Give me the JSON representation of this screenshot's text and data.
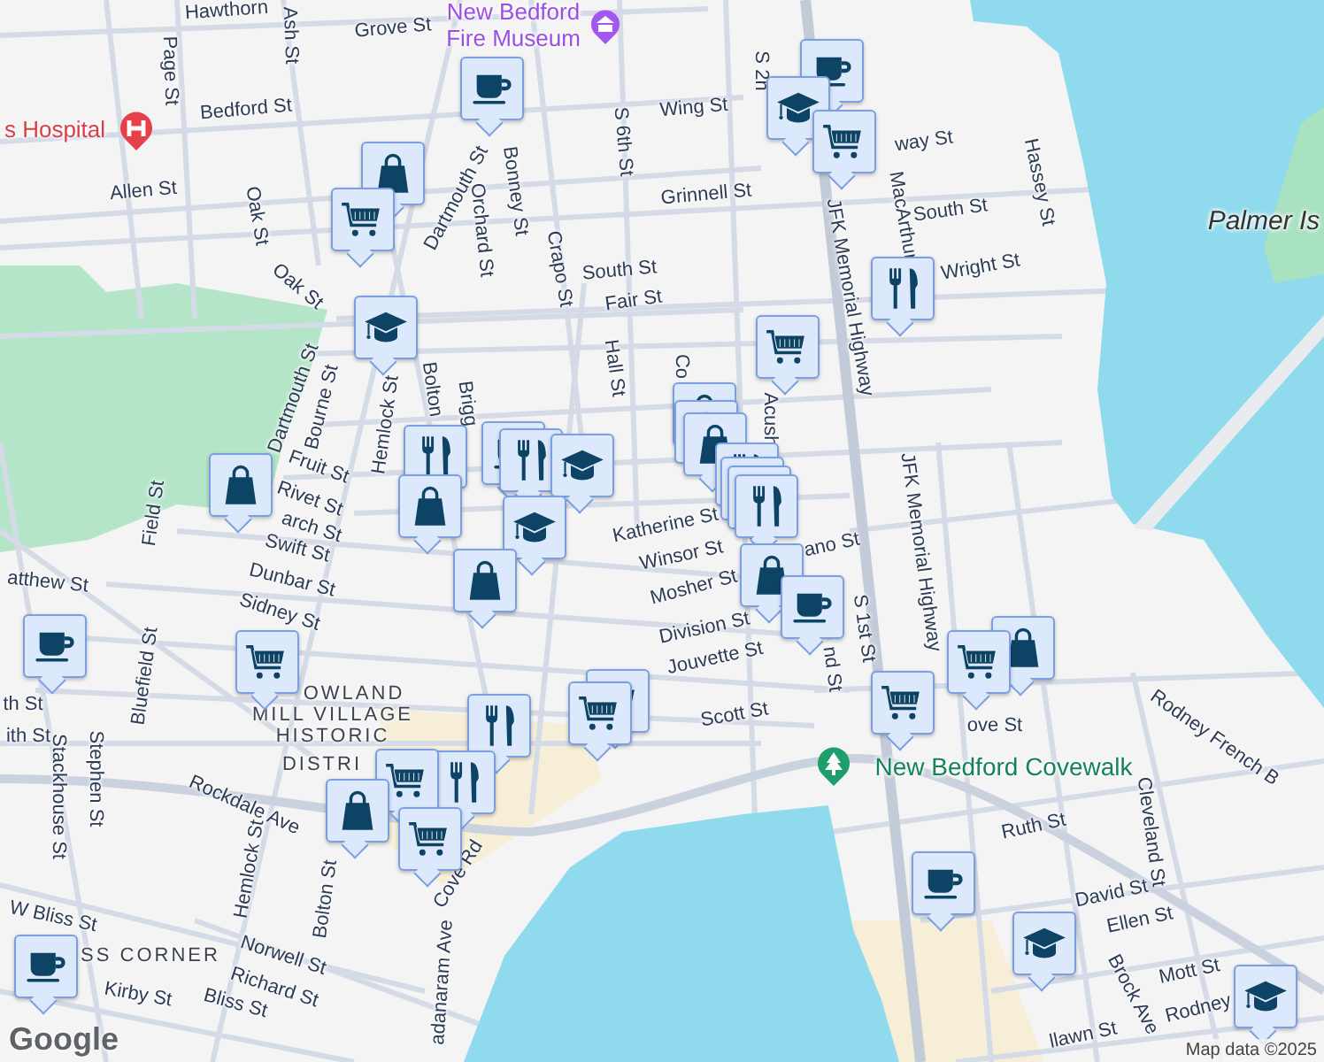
{
  "map": {
    "labels": [
      {
        "text": "Hawthorn",
        "kind": "street"
      },
      {
        "text": "Page St",
        "kind": "street"
      },
      {
        "text": "Ash St",
        "kind": "street"
      },
      {
        "text": "Grove St",
        "kind": "street"
      },
      {
        "text": "New Bedford Fire Museum",
        "kind": "museum"
      },
      {
        "text": "s Hospital",
        "kind": "hospital"
      },
      {
        "text": "Bedford St",
        "kind": "street"
      },
      {
        "text": "S 6th St",
        "kind": "street"
      },
      {
        "text": "Wing St",
        "kind": "street"
      },
      {
        "text": "S 2n",
        "kind": "street"
      },
      {
        "text": "way St",
        "kind": "street"
      },
      {
        "text": "Allen St",
        "kind": "street"
      },
      {
        "text": "Oak St",
        "kind": "street"
      },
      {
        "text": "Dartmouth St",
        "kind": "street"
      },
      {
        "text": "Bonney St",
        "kind": "street"
      },
      {
        "text": "Orchard St",
        "kind": "street"
      },
      {
        "text": "Grinnell St",
        "kind": "street"
      },
      {
        "text": "JFK Memorial Highway",
        "kind": "street"
      },
      {
        "text": "MacArthur",
        "kind": "street"
      },
      {
        "text": "South St",
        "kind": "street"
      },
      {
        "text": "Hassey St",
        "kind": "street"
      },
      {
        "text": "Palmer Is",
        "kind": "island"
      },
      {
        "text": "Oak St",
        "kind": "street"
      },
      {
        "text": "Crapo St",
        "kind": "street"
      },
      {
        "text": "South St",
        "kind": "street"
      },
      {
        "text": "Fair St",
        "kind": "street"
      },
      {
        "text": "Wright St",
        "kind": "street"
      },
      {
        "text": "Hall St",
        "kind": "street"
      },
      {
        "text": "Co",
        "kind": "street"
      },
      {
        "text": "Acush",
        "kind": "street"
      },
      {
        "text": "Dartmouth St",
        "kind": "street"
      },
      {
        "text": "Bourne St",
        "kind": "street"
      },
      {
        "text": "Hemlock St",
        "kind": "street"
      },
      {
        "text": "Bolton",
        "kind": "street"
      },
      {
        "text": "Brigg",
        "kind": "street"
      },
      {
        "text": "Fruit St",
        "kind": "street"
      },
      {
        "text": "Rivet St",
        "kind": "street"
      },
      {
        "text": "Field St",
        "kind": "street"
      },
      {
        "text": "arch St",
        "kind": "street"
      },
      {
        "text": "Katherine St",
        "kind": "street"
      },
      {
        "text": "Winsor St",
        "kind": "street"
      },
      {
        "text": "ano St",
        "kind": "street"
      },
      {
        "text": "Swift St",
        "kind": "street"
      },
      {
        "text": "Dunbar St",
        "kind": "street"
      },
      {
        "text": "atthew St",
        "kind": "street"
      },
      {
        "text": "Mosher St",
        "kind": "street"
      },
      {
        "text": "Sidney St",
        "kind": "street"
      },
      {
        "text": "Division St",
        "kind": "street"
      },
      {
        "text": "S 1st St",
        "kind": "street"
      },
      {
        "text": "JFK Memorial Highway",
        "kind": "street"
      },
      {
        "text": "Jouvette St",
        "kind": "street"
      },
      {
        "text": "nd St",
        "kind": "street"
      },
      {
        "text": "Bluefield St",
        "kind": "street"
      },
      {
        "text": "OWLAND",
        "kind": "district"
      },
      {
        "text": "MILL VILLAGE",
        "kind": "district"
      },
      {
        "text": "HISTORIC",
        "kind": "district"
      },
      {
        "text": "DISTRI",
        "kind": "district"
      },
      {
        "text": "th St",
        "kind": "street"
      },
      {
        "text": "ith St",
        "kind": "street"
      },
      {
        "text": "Scott St",
        "kind": "street"
      },
      {
        "text": "ove St",
        "kind": "street"
      },
      {
        "text": "Rodney French B",
        "kind": "street"
      },
      {
        "text": "New Bedford Covewalk",
        "kind": "park"
      },
      {
        "text": "Stackhouse St",
        "kind": "street"
      },
      {
        "text": "Stephen St",
        "kind": "street"
      },
      {
        "text": "Rockdale Ave",
        "kind": "street"
      },
      {
        "text": "Ruth St",
        "kind": "street"
      },
      {
        "text": "Cleveland St",
        "kind": "street"
      },
      {
        "text": "Cove Rd",
        "kind": "street"
      },
      {
        "text": "Hemlock St",
        "kind": "street"
      },
      {
        "text": "Bolton St",
        "kind": "street"
      },
      {
        "text": "David St",
        "kind": "street"
      },
      {
        "text": "Ellen St",
        "kind": "street"
      },
      {
        "text": "W Bliss St",
        "kind": "street"
      },
      {
        "text": "SS CORNER",
        "kind": "district"
      },
      {
        "text": "Norwell St",
        "kind": "street"
      },
      {
        "text": "Richard St",
        "kind": "street"
      },
      {
        "text": "Kirby St",
        "kind": "street"
      },
      {
        "text": "Bliss St",
        "kind": "street"
      },
      {
        "text": "adanaram Ave",
        "kind": "street"
      },
      {
        "text": "Brock Ave",
        "kind": "street"
      },
      {
        "text": "Mott St",
        "kind": "street"
      },
      {
        "text": "Rodney",
        "kind": "street"
      },
      {
        "text": "llawn St",
        "kind": "street"
      }
    ],
    "pins": [
      {
        "kind": "cafe"
      },
      {
        "kind": "cafe"
      },
      {
        "kind": "school"
      },
      {
        "kind": "grocery"
      },
      {
        "kind": "shopping"
      },
      {
        "kind": "grocery"
      },
      {
        "kind": "restaurant"
      },
      {
        "kind": "school"
      },
      {
        "kind": "grocery"
      },
      {
        "kind": "shopping"
      },
      {
        "kind": "shopping"
      },
      {
        "kind": "shopping"
      },
      {
        "kind": "restaurant"
      },
      {
        "kind": "restaurant"
      },
      {
        "kind": "restaurant"
      },
      {
        "kind": "restaurant"
      },
      {
        "kind": "cafe"
      },
      {
        "kind": "restaurant"
      },
      {
        "kind": "restaurant"
      },
      {
        "kind": "school"
      },
      {
        "kind": "shopping"
      },
      {
        "kind": "shopping"
      },
      {
        "kind": "school"
      },
      {
        "kind": "shopping"
      },
      {
        "kind": "shopping"
      },
      {
        "kind": "cafe"
      },
      {
        "kind": "cafe"
      },
      {
        "kind": "grocery"
      },
      {
        "kind": "shopping"
      },
      {
        "kind": "grocery"
      },
      {
        "kind": "grocery"
      },
      {
        "kind": "grocery"
      },
      {
        "kind": "grocery"
      },
      {
        "kind": "restaurant"
      },
      {
        "kind": "restaurant"
      },
      {
        "kind": "grocery"
      },
      {
        "kind": "shopping"
      },
      {
        "kind": "grocery"
      },
      {
        "kind": "cafe"
      },
      {
        "kind": "school"
      },
      {
        "kind": "school"
      },
      {
        "kind": "cafe"
      }
    ],
    "attribution": "Map data ©2025",
    "logo": "Google"
  }
}
